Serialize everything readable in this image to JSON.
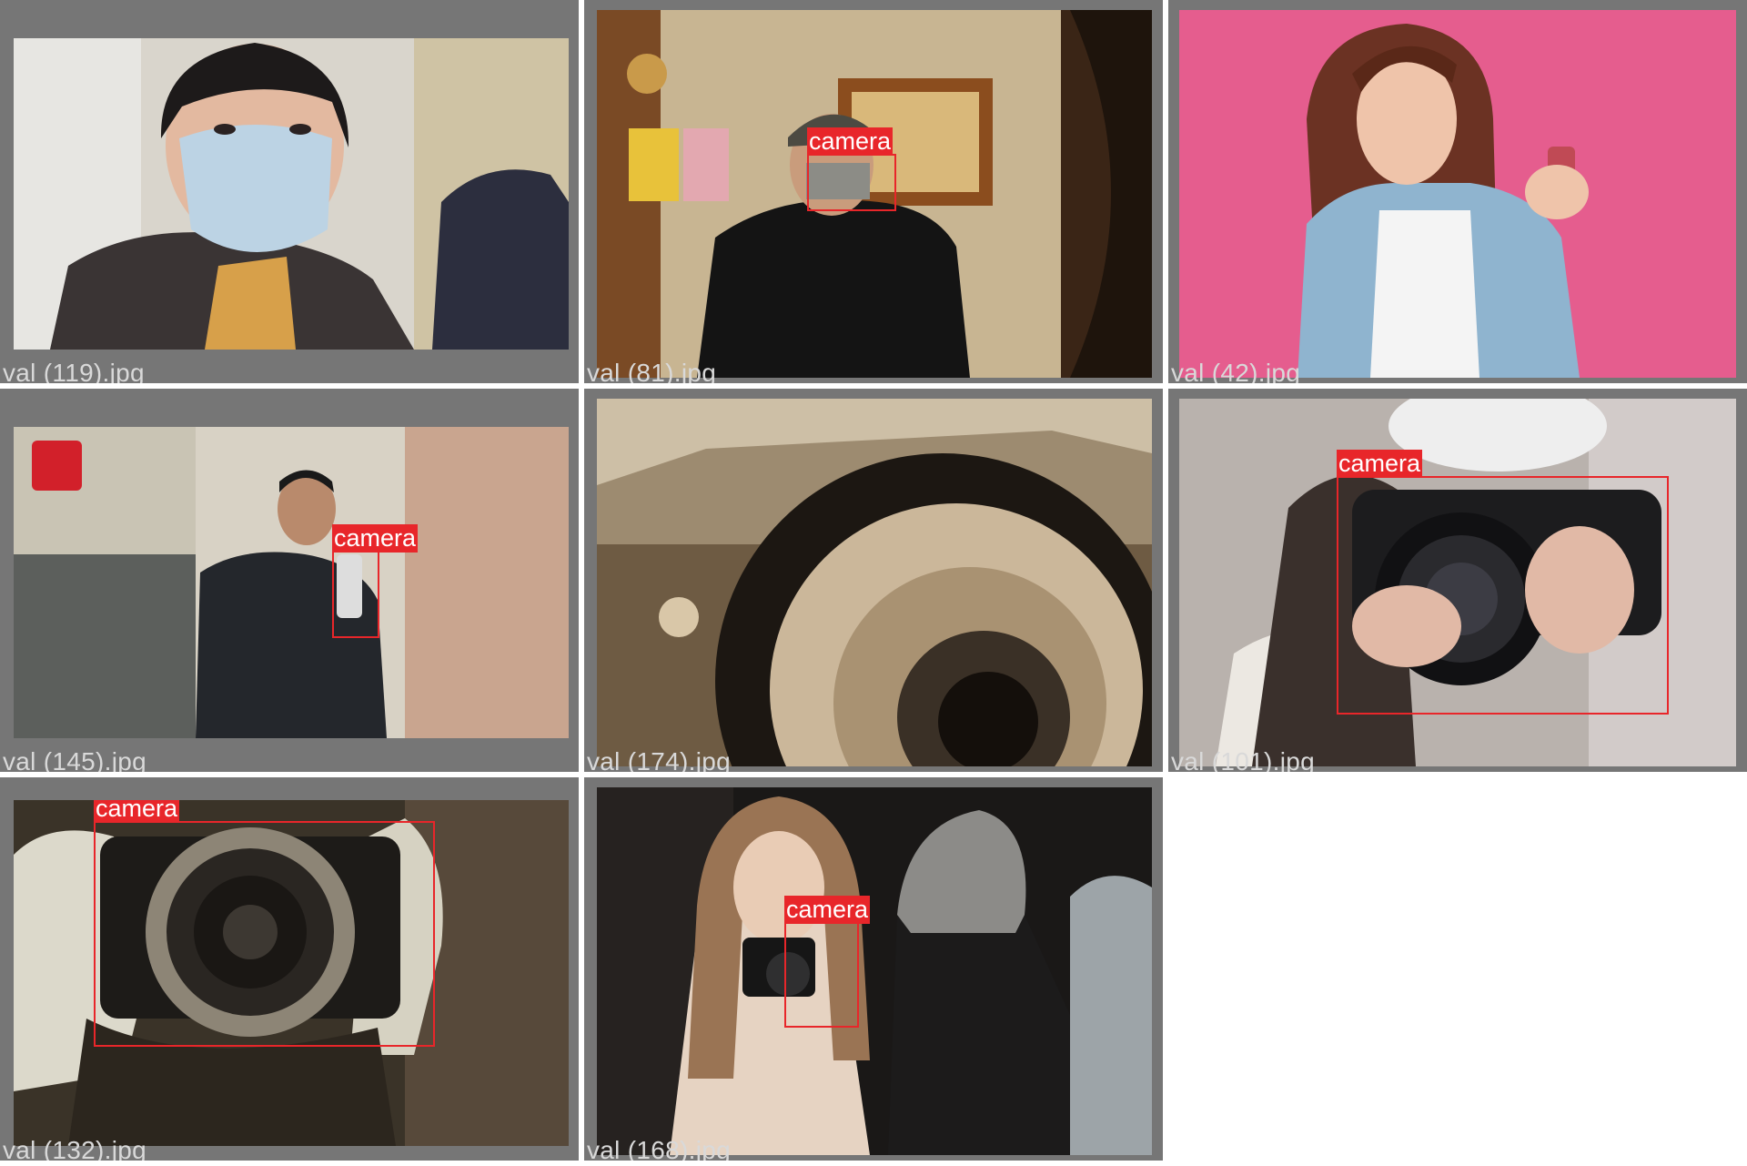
{
  "tiles": [
    {
      "filename": "val (119).jpg",
      "detections": []
    },
    {
      "filename": "val (81).jpg",
      "detections": [
        {
          "label": "camera"
        }
      ]
    },
    {
      "filename": "val (42).jpg",
      "detections": []
    },
    {
      "filename": "val (145).jpg",
      "detections": [
        {
          "label": "camera"
        }
      ]
    },
    {
      "filename": "val (174).jpg",
      "detections": []
    },
    {
      "filename": "val (101).jpg",
      "detections": [
        {
          "label": "camera"
        }
      ]
    },
    {
      "filename": "val (132).jpg",
      "detections": [
        {
          "label": "camera"
        }
      ]
    },
    {
      "filename": "val (168).jpg",
      "detections": [
        {
          "label": "camera"
        }
      ]
    }
  ],
  "colors": {
    "tile_background": "#767676",
    "filename_text": "#d9d9d9",
    "bbox": "#e8262a",
    "bbox_label_text": "#ffffff"
  }
}
